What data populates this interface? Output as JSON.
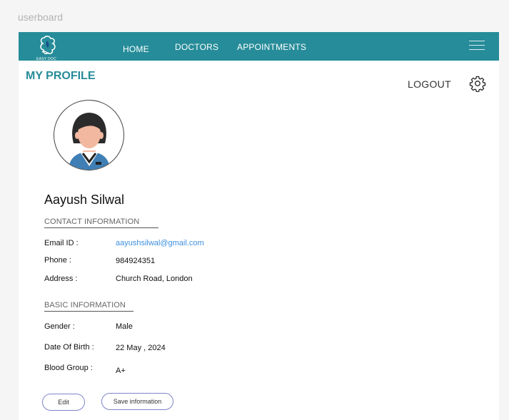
{
  "frame": {
    "label": "userboard"
  },
  "nav": {
    "logo_text": "EASY DOC",
    "items": [
      "HOME",
      "DOCTORS",
      "APPOINTMENTS"
    ],
    "accent_color": "#268c99"
  },
  "header": {
    "title": "MY PROFILE",
    "logout": "LOGOUT"
  },
  "profile": {
    "name": "Aayush Silwal",
    "contact": {
      "title": "CONTACT INFORMATION",
      "email_label": "Email ID :",
      "email": "aayushsilwal@gmail.com",
      "phone_label": "Phone :",
      "phone": "984924351",
      "address_label": "Address :",
      "address": "Church Road, London"
    },
    "basic": {
      "title": "BASIC INFORMATION",
      "gender_label": "Gender  :",
      "gender": "Male",
      "dob_label": "Date Of Birth :",
      "dob": "22 May , 2024",
      "blood_label": "Blood Group :",
      "blood": "A+"
    }
  },
  "actions": {
    "edit": "Edit",
    "save": "Save information"
  },
  "icons": [
    "logo-icon",
    "hamburger-menu-icon",
    "gear-icon",
    "avatar-icon"
  ]
}
